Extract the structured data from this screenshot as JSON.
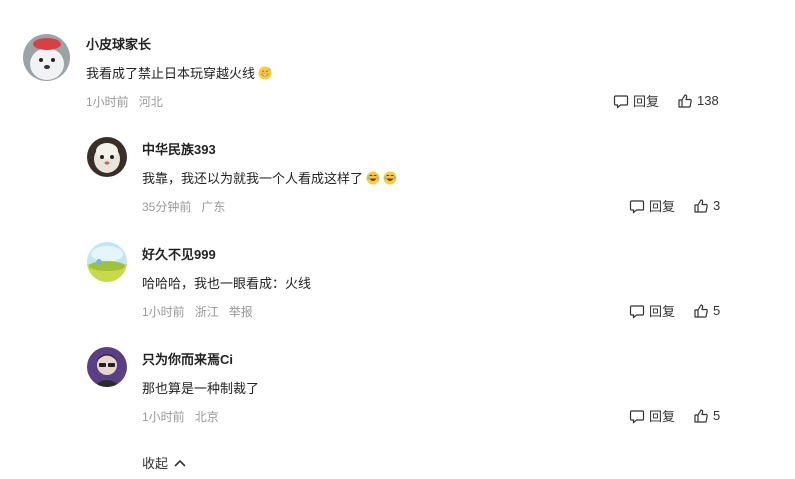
{
  "comments": [
    {
      "user": "小皮球家长",
      "text": "我看成了禁止日本玩穿越火线",
      "emoji": "grinning-sweat-emoji",
      "time": "1小时前",
      "location": "河北",
      "reply_label": "回复",
      "likes": "138"
    },
    {
      "user": "中华民族393",
      "text": "我靠，我还以为就我一个人看成这样了",
      "emoji": "laughing-tears-emoji",
      "time": "35分钟前",
      "location": "广东",
      "reply_label": "回复",
      "likes": "3"
    },
    {
      "user": "好久不见999",
      "text": "哈哈哈，我也一眼看成：火线",
      "time": "1小时前",
      "location": "浙江",
      "report_label": "举报",
      "reply_label": "回复",
      "likes": "5"
    },
    {
      "user": "只为你而来焉Ci",
      "text": "那也算是一种制裁了",
      "time": "1小时前",
      "location": "北京",
      "reply_label": "回复",
      "likes": "5"
    }
  ],
  "collapse_label": "收起",
  "colors": {
    "meta": "#999999",
    "text": "#222222"
  }
}
